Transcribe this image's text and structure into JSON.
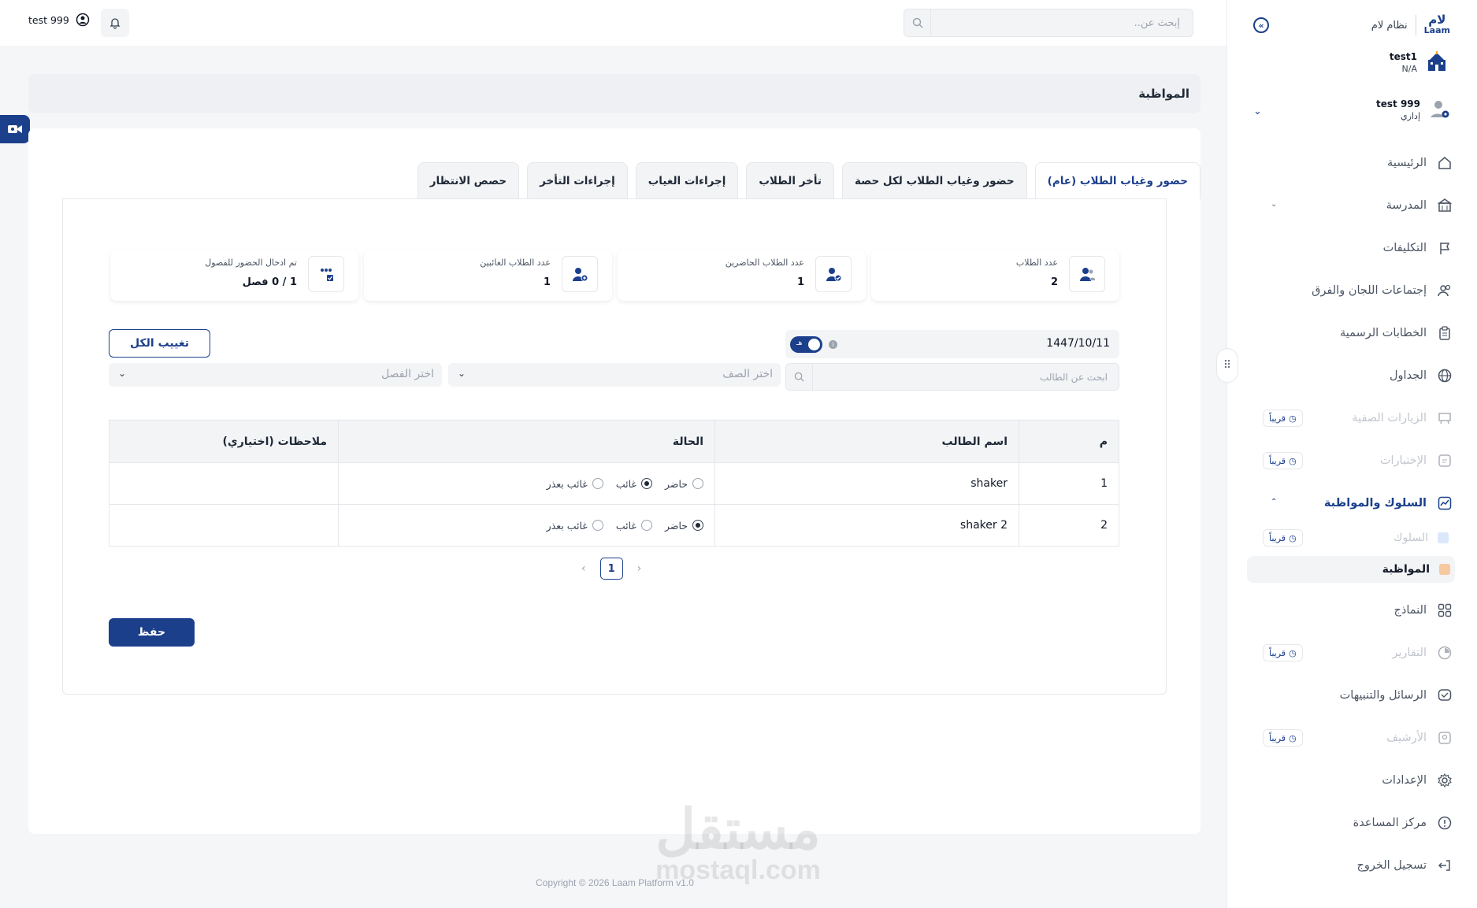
{
  "sidebar": {
    "brand_logo": "لام",
    "brand_logo_sub": "Laam",
    "system_name": "نظام لام",
    "school": {
      "name": "test1",
      "code": "N/A"
    },
    "user": {
      "name": "test 999",
      "role": "إداري"
    },
    "soon_label": "قريباً",
    "items": [
      {
        "label": "الرئيسية",
        "icon": "home-icon"
      },
      {
        "label": "المدرسة",
        "icon": "school-building-icon"
      },
      {
        "label": "التكليفات",
        "icon": "flag-icon"
      },
      {
        "label": "إجتماعات اللجان والفرق",
        "icon": "users-icon"
      },
      {
        "label": "الخطابات الرسمية",
        "icon": "clipboard-icon"
      },
      {
        "label": "الجداول",
        "icon": "globe-grid-icon"
      },
      {
        "label": "الزيارات الصفية",
        "icon": "classroom-icon"
      },
      {
        "label": "الإختبارات",
        "icon": "exam-icon"
      },
      {
        "label": "السلوك والمواظبة",
        "icon": "chart-line-icon"
      },
      {
        "label": "النماذج",
        "icon": "grid-icon"
      },
      {
        "label": "التقارير",
        "icon": "report-icon"
      },
      {
        "label": "الرسائل والتنبيهات",
        "icon": "message-icon"
      },
      {
        "label": "الأرشيف",
        "icon": "archive-icon"
      },
      {
        "label": "الإعدادات",
        "icon": "gear-icon"
      },
      {
        "label": "مركز المساعدة",
        "icon": "help-icon"
      },
      {
        "label": "تسجيل الخروج",
        "icon": "logout-icon"
      }
    ],
    "sub_items": [
      {
        "label": "السلوك",
        "color": "#dbe7fb"
      },
      {
        "label": "المواظبة",
        "color": "#f6c9a0"
      }
    ]
  },
  "header": {
    "search_placeholder": "إبحث عن..",
    "user_name": "test 999"
  },
  "page": {
    "title": "المواظبة",
    "tabs": [
      "حضور وغياب الطلاب (عام)",
      "حضور وغياب الطلاب لكل حصة",
      "تأخر الطلاب",
      "إجراءات الغياب",
      "إجراءات التأخر",
      "حصص الانتظار"
    ],
    "stats": [
      {
        "title": "عدد الطلاب",
        "value": "2"
      },
      {
        "title": "عدد الطلاب الحاضرين",
        "value": "1"
      },
      {
        "title": "عدد الطلاب الغائبين",
        "value": "1"
      },
      {
        "title": "تم ادخال الحضور للفصول",
        "value": "1 / 0 فصل"
      }
    ],
    "date": "1447/10/11",
    "toggle_label": "هـ",
    "student_search_placeholder": "ابحث عن الطالب",
    "grade_placeholder": "اختر الصف",
    "class_placeholder": "اختر الفصل",
    "absent_all_label": "تغييب الكل",
    "table": {
      "headers": [
        "م",
        "اسم الطالب",
        "الحالة",
        "ملاحظات (اختياري)"
      ],
      "status_options": [
        "حاضر",
        "غائب",
        "غائب بعذر"
      ],
      "rows": [
        {
          "num": "1",
          "name": "shaker",
          "status": "غائب"
        },
        {
          "num": "2",
          "name": "shaker 2",
          "status": "حاضر"
        }
      ]
    },
    "pagination": {
      "current": "1"
    },
    "save_label": "حفظ"
  },
  "footer": {
    "text": "Copyright © 2026 Laam Platform v1.0"
  },
  "watermark": {
    "ar": "مستقل",
    "en": "mostaql.com"
  },
  "colors": {
    "primary": "#1b3f8b",
    "background": "#f5f6f8",
    "panel": "#ffffff"
  }
}
